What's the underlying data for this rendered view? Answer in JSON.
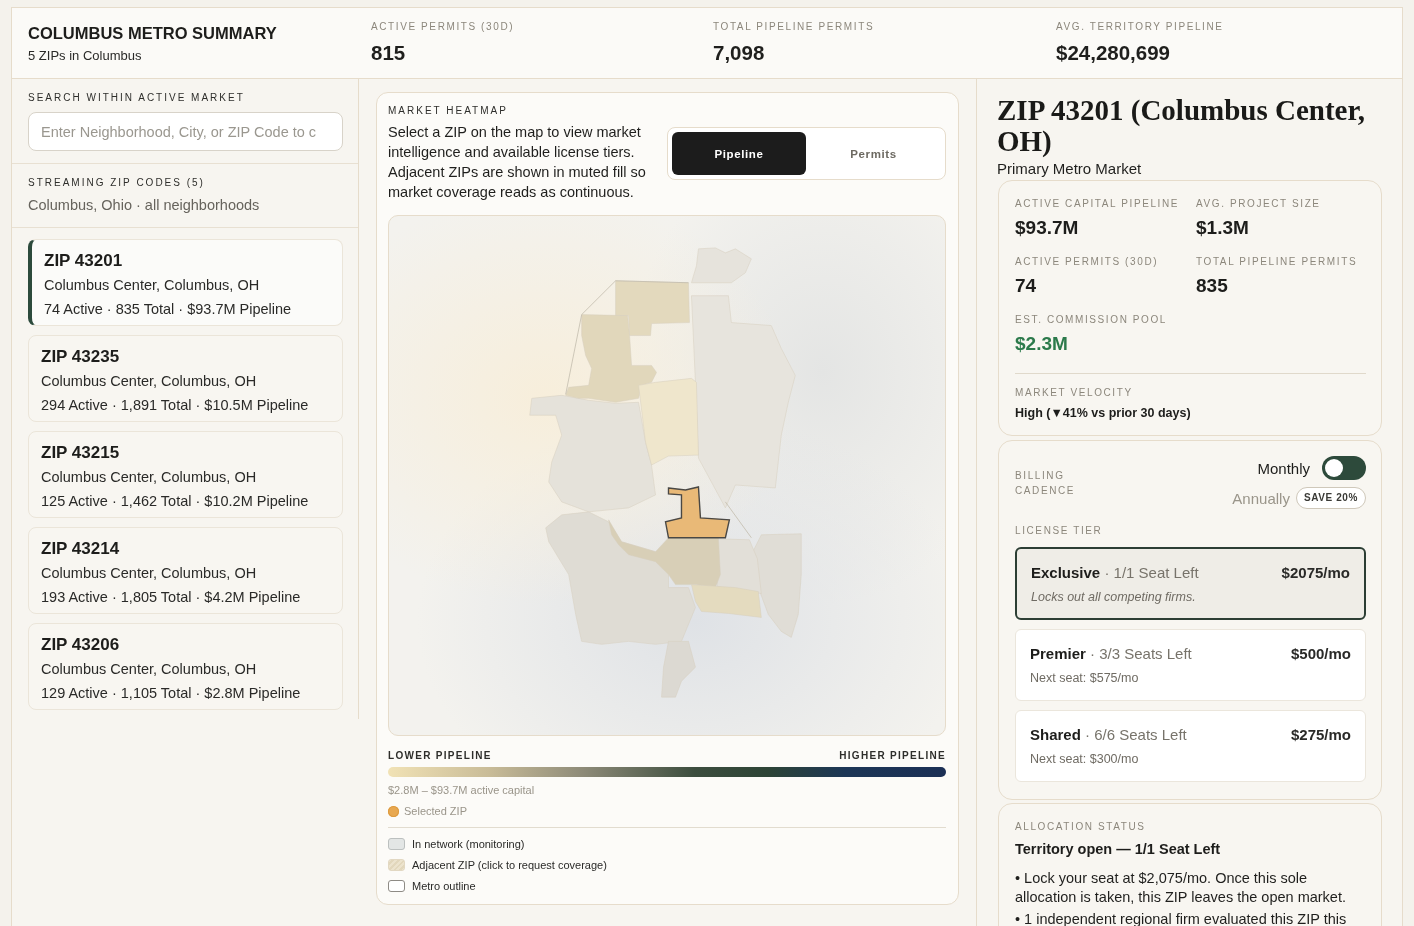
{
  "header": {
    "title": "COLUMBUS METRO SUMMARY",
    "subtitle": "5 ZIPs in Columbus",
    "stats": [
      {
        "label": "ACTIVE PERMITS (30D)",
        "value": "815"
      },
      {
        "label": "TOTAL PIPELINE PERMITS",
        "value": "7,098"
      },
      {
        "label": "AVG. TERRITORY PIPELINE",
        "value": "$24,280,699"
      }
    ]
  },
  "sidebar": {
    "search_label": "SEARCH WITHIN ACTIVE MARKET",
    "search": {
      "placeholder": "Enter Neighborhood, City, or ZIP Code to c"
    },
    "streaming_label": "STREAMING ZIP CODES (5)",
    "streaming_subtitle": "Columbus, Ohio · all neighborhoods",
    "zips": [
      {
        "zip": "ZIP 43201",
        "area": "Columbus Center, Columbus, OH",
        "stats": "74 Active · 835 Total · $93.7M Pipeline",
        "selected": true
      },
      {
        "zip": "ZIP 43235",
        "area": "Columbus Center, Columbus, OH",
        "stats": "294 Active · 1,891 Total · $10.5M Pipeline",
        "selected": false
      },
      {
        "zip": "ZIP 43215",
        "area": "Columbus Center, Columbus, OH",
        "stats": "125 Active · 1,462 Total · $10.2M Pipeline",
        "selected": false
      },
      {
        "zip": "ZIP 43214",
        "area": "Columbus Center, Columbus, OH",
        "stats": "193 Active · 1,805 Total · $4.2M Pipeline",
        "selected": false
      },
      {
        "zip": "ZIP 43206",
        "area": "Columbus Center, Columbus, OH",
        "stats": "129 Active · 1,105 Total · $2.8M Pipeline",
        "selected": false
      }
    ]
  },
  "heatmap": {
    "label": "MARKET HEATMAP",
    "description": "Select a ZIP on the map to view market intelligence and available license tiers. Adjacent ZIPs are shown in muted fill so market coverage reads as continuous.",
    "modes": [
      {
        "label": "Pipeline",
        "selected": true
      },
      {
        "label": "Permits",
        "selected": false
      }
    ],
    "scale": {
      "low": "LOWER PIPELINE",
      "high": "HIGHER PIPELINE",
      "range": "$2.8M – $93.7M active capital"
    },
    "selected_label": "Selected ZIP",
    "legend": [
      {
        "kind": "in_network",
        "label": "In network (monitoring)"
      },
      {
        "kind": "adjacent",
        "label": "Adjacent ZIP (click to request coverage)"
      },
      {
        "kind": "outline",
        "label": "Metro outline"
      }
    ]
  },
  "detail": {
    "title": "ZIP 43201 (Columbus Center, OH)",
    "subtitle": "Primary Metro Market",
    "stats": [
      {
        "label": "ACTIVE CAPITAL PIPELINE",
        "value": "$93.7M",
        "kind": "plain"
      },
      {
        "label": "AVG. PROJECT SIZE",
        "value": "$1.3M",
        "kind": "plain"
      },
      {
        "label": "ACTIVE PERMITS (30D)",
        "value": "74",
        "kind": "plain"
      },
      {
        "label": "TOTAL PIPELINE PERMITS",
        "value": "835",
        "kind": "plain"
      },
      {
        "label": "EST. COMMISSION POOL",
        "value": "$2.3M",
        "kind": "accent"
      }
    ],
    "velocity_label": "MARKET VELOCITY",
    "velocity": "High (▼41% vs prior 30 days)"
  },
  "billing": {
    "label": "BILLING CADENCE",
    "options": [
      {
        "label": "Monthly",
        "selected": true
      },
      {
        "label": "Annually",
        "selected": false,
        "badge": "SAVE 20%"
      }
    ],
    "tier_label": "LICENSE TIER",
    "tiers": [
      {
        "kind": "exclusive",
        "title": "**Exclusive** · 1/1 Seat Left",
        "price": "$2075/mo",
        "note": "Locks out all competing firms.",
        "selected": true
      },
      {
        "kind": "seat",
        "title": "**Premier** · 3/3 Seats Left",
        "price": "$500/mo",
        "note": "Next seat: $575/mo",
        "selected": false
      },
      {
        "kind": "seat",
        "title": "**Shared** · 6/6 Seats Left",
        "price": "$275/mo",
        "note": "Next seat: $300/mo",
        "selected": false
      }
    ]
  },
  "allocation": {
    "label": "ALLOCATION STATUS",
    "headline": "Territory open — 1/1 Seat Left",
    "bullets": [
      "• Lock your seat at $2,075/mo. Once this sole allocation is taken, this ZIP leaves the open market.",
      "• 1 independent regional firm evaluated this ZIP this"
    ]
  }
}
